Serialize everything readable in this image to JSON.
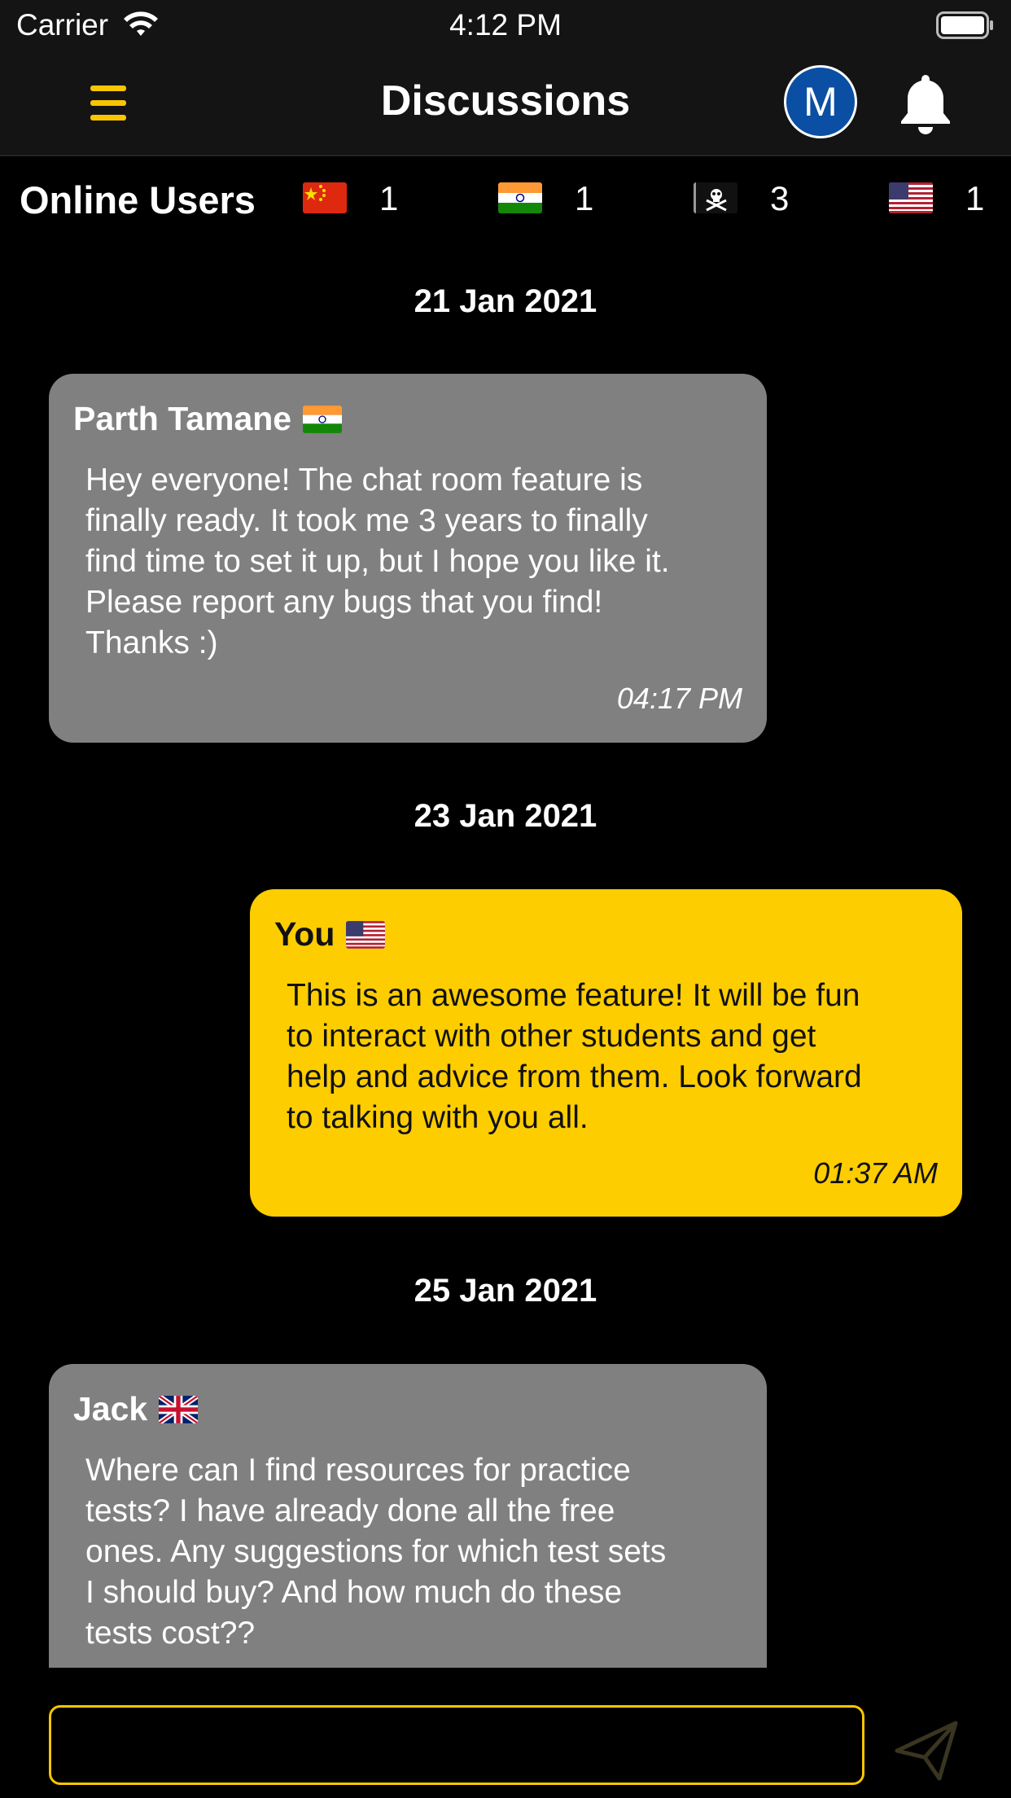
{
  "status_bar": {
    "carrier": "Carrier",
    "time": "4:12 PM"
  },
  "nav": {
    "title": "Discussions",
    "avatar_initial": "M",
    "accent": "#f7c600"
  },
  "online": {
    "title": "Online Users",
    "countries": [
      {
        "flag": "china-flag-icon",
        "count": "1"
      },
      {
        "flag": "india-flag-icon",
        "count": "1"
      },
      {
        "flag": "pirate-flag-icon",
        "count": "3"
      },
      {
        "flag": "usa-flag-icon",
        "count": "1"
      }
    ]
  },
  "messages": [
    {
      "date": "21 Jan 2021",
      "sender": "Parth Tamane",
      "flag": "india-flag-icon",
      "text_lines": [
        "Hey everyone! The chat room feature is",
        "finally ready. It took me 3 years to finally",
        "find time to set it up, but I hope you like it.",
        "Please report any bugs that you find!",
        "Thanks :)"
      ],
      "time": "04:17 PM",
      "mine": false
    },
    {
      "date": "23 Jan 2021",
      "sender": "You",
      "flag": "usa-flag-icon",
      "text_lines": [
        "This is an awesome feature! It will be fun",
        "to interact with other students and get",
        "help and advice from them. Look forward",
        "to talking with you all."
      ],
      "time": "01:37 AM",
      "mine": true
    },
    {
      "date": "25 Jan 2021",
      "sender": "Jack",
      "flag": "uk-flag-icon",
      "text_lines": [
        "Where can I find resources for practice",
        "tests? I have already done all the free",
        "ones. Any suggestions for which test sets",
        "I should buy? And how much do these",
        "tests cost??"
      ],
      "time": "",
      "mine": false
    }
  ],
  "composer": {
    "placeholder": ""
  },
  "colors": {
    "mine_bubble": "#fdcd00",
    "other_bubble": "#808080",
    "avatar": "#0a4fa3"
  }
}
